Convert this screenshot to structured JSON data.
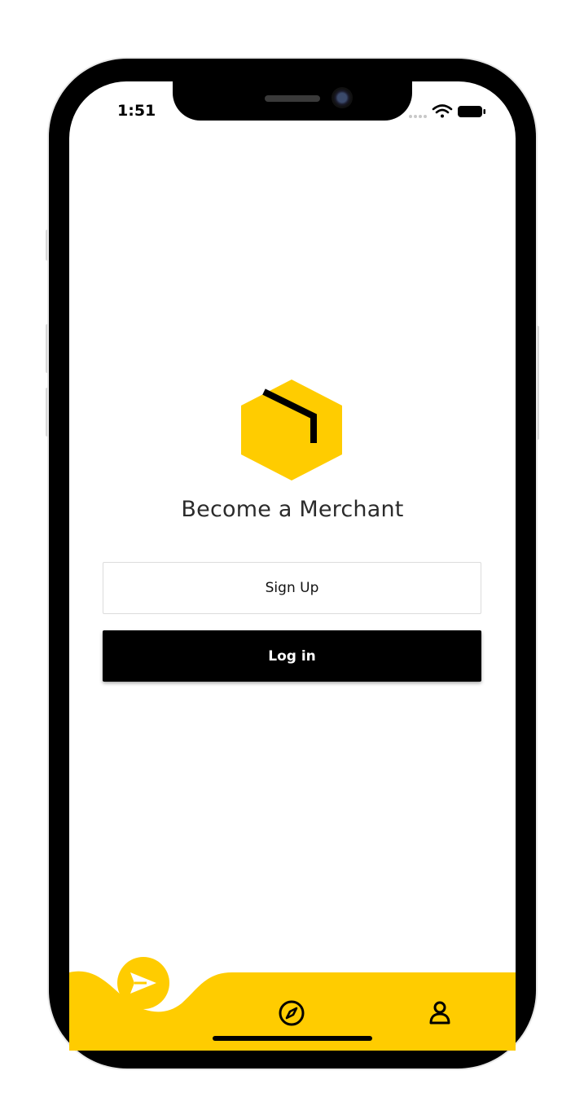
{
  "status_bar": {
    "time": "1:51"
  },
  "main": {
    "title": "Become a Merchant",
    "signup_label": "Sign Up",
    "login_label": "Log in"
  },
  "tabbar": {
    "items": [
      {
        "icon": "send-icon",
        "active": true
      },
      {
        "icon": "compass-icon",
        "active": false
      },
      {
        "icon": "user-icon",
        "active": false
      }
    ]
  },
  "colors": {
    "accent": "#ffcc00",
    "primary_button": "#000000",
    "text": "#2b2b2b"
  }
}
